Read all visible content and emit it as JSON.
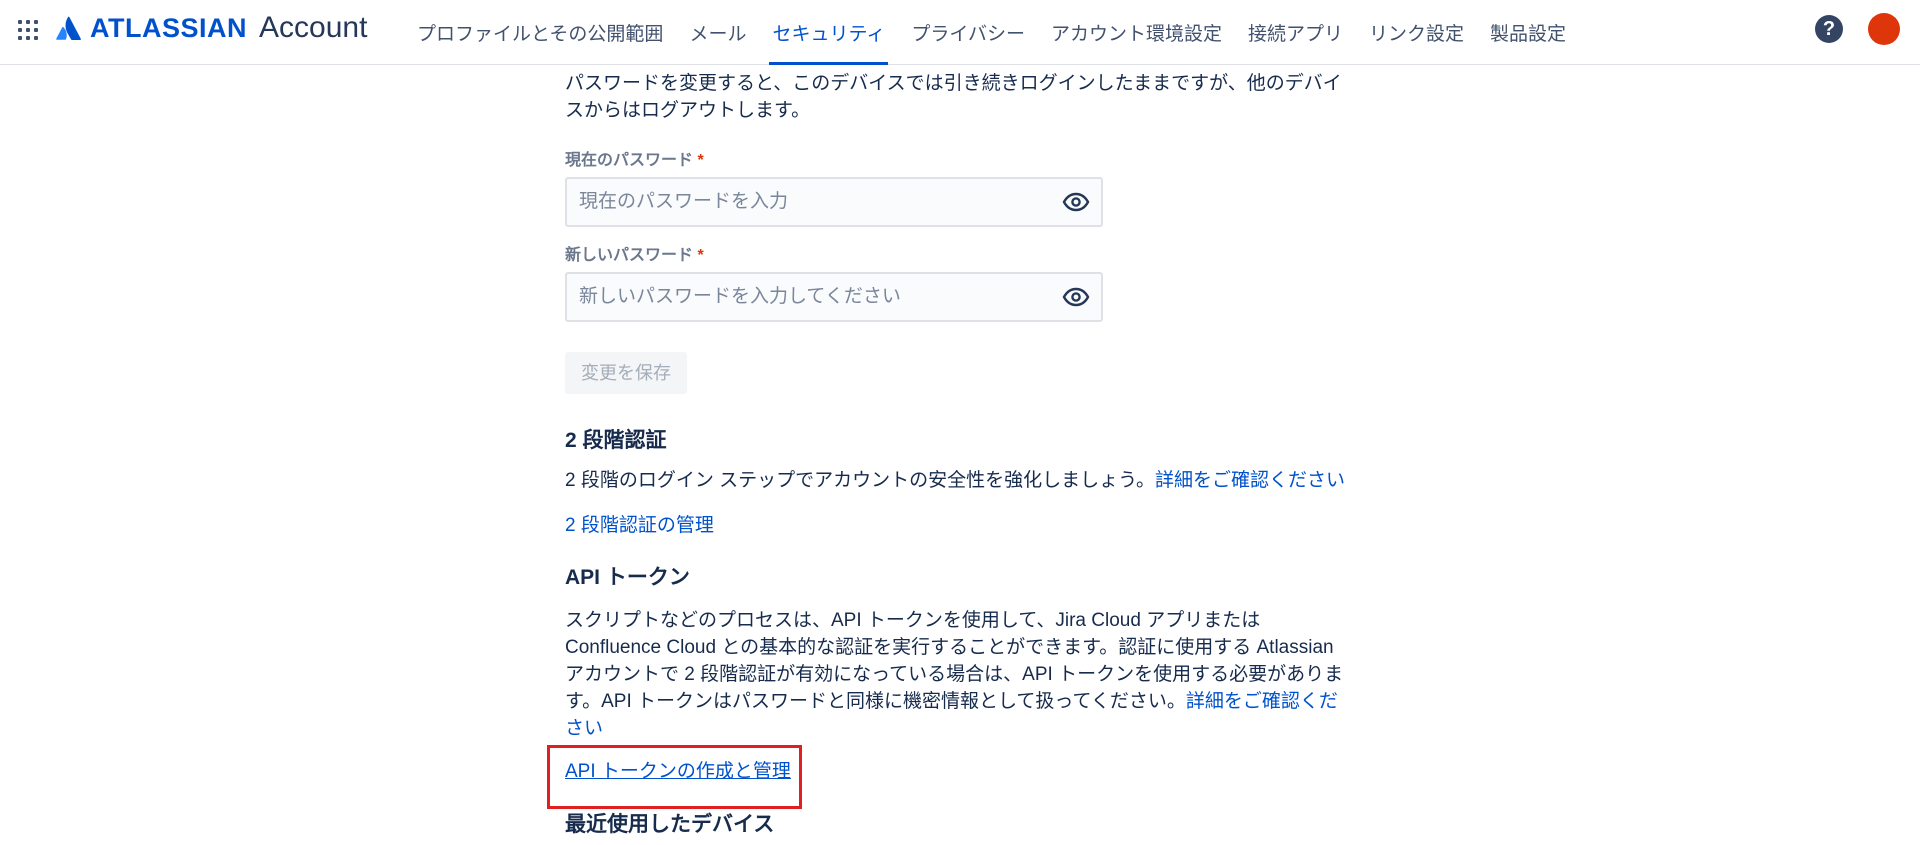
{
  "header": {
    "brand_word": "ATLASSIAN",
    "brand_product": "Account",
    "icons": {
      "app_switcher": "grid-icon",
      "logo": "atlassian-logo-icon",
      "help": "help-icon",
      "avatar": "avatar"
    },
    "help_glyph": "?",
    "nav": [
      {
        "label": "プロファイルとその公開範囲"
      },
      {
        "label": "メール"
      },
      {
        "label": "セキュリティ",
        "active": true
      },
      {
        "label": "プライバシー"
      },
      {
        "label": "アカウント環境設定"
      },
      {
        "label": "接続アプリ"
      },
      {
        "label": "リンク設定"
      },
      {
        "label": "製品設定"
      }
    ]
  },
  "password": {
    "intro": "パスワードを変更すると、このデバイスでは引き続きログインしたままですが、他のデバイスからはログアウトします。",
    "current_label": "現在のパスワード",
    "current_placeholder": "現在のパスワードを入力",
    "new_label": "新しいパスワード",
    "new_placeholder": "新しいパスワードを入力してください",
    "required_mark": "*",
    "save_label": "変更を保存"
  },
  "two_step": {
    "title": "2 段階認証",
    "text": "2 段階のログイン ステップでアカウントの安全性を強化しましょう。",
    "learn_more": "詳細をご確認ください",
    "manage_link": "2 段階認証の管理"
  },
  "api_tokens": {
    "title": "API トークン",
    "text": "スクリプトなどのプロセスは、API トークンを使用して、Jira Cloud アプリまたは Confluence Cloud との基本的な認証を実行することができます。認証に使用する Atlassian アカウントで 2 段階認証が有効になっている場合は、API トークンを使用する必要があります。API トークンはパスワードと同様に機密情報として扱ってください。",
    "learn_more": "詳細をご確認ください",
    "manage_link": "API トークンの作成と管理"
  },
  "recent_devices": {
    "title": "最近使用したデバイス"
  },
  "colors": {
    "accent": "#0052CC",
    "highlight": "#E02020",
    "avatar": "#DE350B",
    "text": "#172B4D"
  }
}
